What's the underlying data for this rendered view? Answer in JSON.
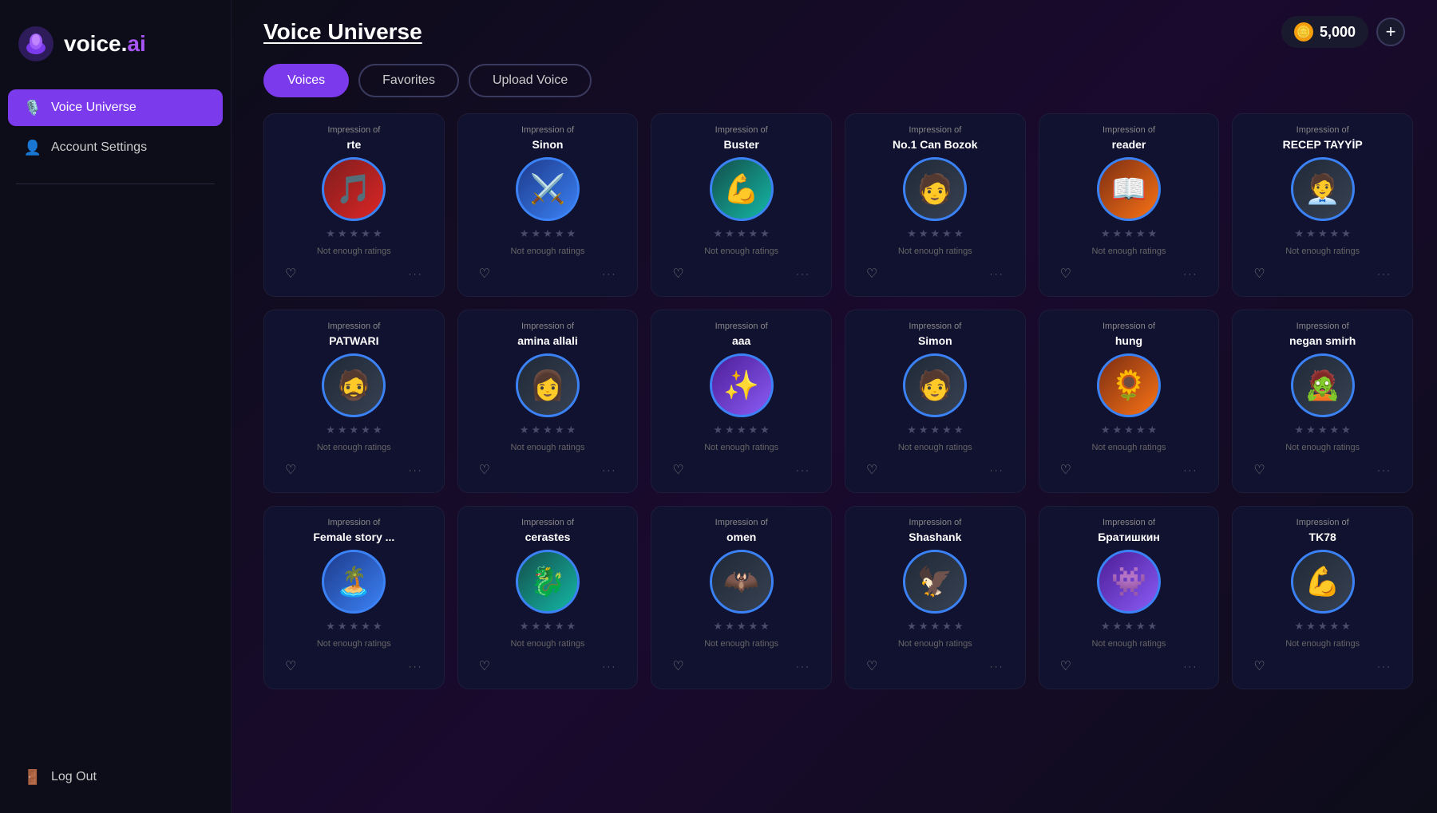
{
  "sidebar": {
    "logo_text": "voice.ai",
    "items": [
      {
        "id": "voice-universe",
        "label": "Voice Universe",
        "icon": "🎙️",
        "active": true
      },
      {
        "id": "account-settings",
        "label": "Account Settings",
        "icon": "👤",
        "active": false
      }
    ],
    "logout_label": "Log Out",
    "logout_icon": "🚪"
  },
  "header": {
    "title": "Voice Universe",
    "credits": "5,000",
    "coin_symbol": "🪙",
    "add_label": "+"
  },
  "tabs": [
    {
      "id": "voices",
      "label": "Voices",
      "active": true
    },
    {
      "id": "favorites",
      "label": "Favorites",
      "active": false
    },
    {
      "id": "upload-voice",
      "label": "Upload Voice",
      "active": false
    }
  ],
  "voices": [
    {
      "label": "Impression of",
      "name": "rte",
      "avatar_color": "av-red",
      "avatar_emoji": "🎵",
      "rating_text": "Not enough ratings"
    },
    {
      "label": "Impression of",
      "name": "Sinon",
      "avatar_color": "av-blue",
      "avatar_emoji": "⚔️",
      "rating_text": "Not enough ratings"
    },
    {
      "label": "Impression of",
      "name": "Buster",
      "avatar_color": "av-teal",
      "avatar_emoji": "💪",
      "rating_text": "Not enough ratings"
    },
    {
      "label": "Impression of",
      "name": "No.1 Can Bozok",
      "avatar_color": "av-dark",
      "avatar_emoji": "🧑",
      "rating_text": "Not enough ratings"
    },
    {
      "label": "Impression of",
      "name": "reader",
      "avatar_color": "av-orange",
      "avatar_emoji": "📖",
      "rating_text": "Not enough ratings"
    },
    {
      "label": "Impression of",
      "name": "RECEP TAYYİP",
      "avatar_color": "av-dark",
      "avatar_emoji": "🧑‍💼",
      "rating_text": "Not enough ratings"
    },
    {
      "label": "Impression of",
      "name": "PATWARI",
      "avatar_color": "av-dark",
      "avatar_emoji": "🧔",
      "rating_text": "Not enough ratings"
    },
    {
      "label": "Impression of",
      "name": "amina allali",
      "avatar_color": "av-dark",
      "avatar_emoji": "👩",
      "rating_text": "Not enough ratings"
    },
    {
      "label": "Impression of",
      "name": "aaa",
      "avatar_color": "av-purple",
      "avatar_emoji": "✨",
      "rating_text": "Not enough ratings"
    },
    {
      "label": "Impression of",
      "name": "Simon",
      "avatar_color": "av-dark",
      "avatar_emoji": "🧑",
      "rating_text": "Not enough ratings"
    },
    {
      "label": "Impression of",
      "name": "hung",
      "avatar_color": "av-orange",
      "avatar_emoji": "🌻",
      "rating_text": "Not enough ratings"
    },
    {
      "label": "Impression of",
      "name": "negan smirh",
      "avatar_color": "av-dark",
      "avatar_emoji": "🧟",
      "rating_text": "Not enough ratings"
    },
    {
      "label": "Impression of",
      "name": "Female story ...",
      "avatar_color": "av-blue",
      "avatar_emoji": "🏝️",
      "rating_text": "Not enough ratings"
    },
    {
      "label": "Impression of",
      "name": "cerastes",
      "avatar_color": "av-teal",
      "avatar_emoji": "🐉",
      "rating_text": "Not enough ratings"
    },
    {
      "label": "Impression of",
      "name": "omen",
      "avatar_color": "av-dark",
      "avatar_emoji": "🦇",
      "rating_text": "Not enough ratings"
    },
    {
      "label": "Impression of",
      "name": "Shashank",
      "avatar_color": "av-dark",
      "avatar_emoji": "🦅",
      "rating_text": "Not enough ratings"
    },
    {
      "label": "Impression of",
      "name": "Братишкин",
      "avatar_color": "av-purple",
      "avatar_emoji": "👾",
      "rating_text": "Not enough ratings"
    },
    {
      "label": "Impression of",
      "name": "TK78",
      "avatar_color": "av-dark",
      "avatar_emoji": "💪",
      "rating_text": "Not enough ratings"
    }
  ],
  "stars_count": 5,
  "heart_icon": "♡",
  "more_icon": "···",
  "rating_text_default": "Not enough ratings"
}
